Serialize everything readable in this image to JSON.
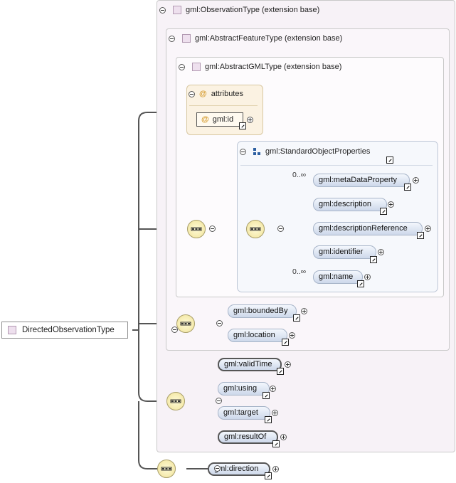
{
  "root": {
    "label": "DirectedObservationType"
  },
  "groups": {
    "observation_type": "gml:ObservationType (extension base)",
    "abstract_feature_type": "gml:AbstractFeatureType (extension base)",
    "abstract_gml_type": "gml:AbstractGMLType (extension base)"
  },
  "attributes": {
    "title": "attributes",
    "at_symbol": "@",
    "items": [
      "gml:id"
    ]
  },
  "standard_object_properties": {
    "title": "gml:StandardObjectProperties",
    "elements": [
      {
        "label": "gml:metaDataProperty",
        "cardinality": "0..∞"
      },
      {
        "label": "gml:description",
        "cardinality": ""
      },
      {
        "label": "gml:descriptionReference",
        "cardinality": ""
      },
      {
        "label": "gml:identifier",
        "cardinality": ""
      },
      {
        "label": "gml:name",
        "cardinality": "0..∞"
      }
    ]
  },
  "feature_elements": [
    "gml:boundedBy",
    "gml:location"
  ],
  "observation_elements": [
    "gml:validTime",
    "gml:using",
    "gml:target",
    "gml:resultOf"
  ],
  "directed_elements": [
    "gml:direction"
  ],
  "icons": [
    "collapse-icon",
    "expand-icon",
    "sequence-compositor-icon",
    "link-arrow-icon",
    "type-square-icon",
    "attribute-at-icon",
    "standard-properties-icon"
  ],
  "colors": {
    "type_square": "#eee0ee",
    "pill_fill": "#cdd8ea",
    "attribute_box": "#fbf2e2",
    "compositor": "#f0e29a"
  }
}
